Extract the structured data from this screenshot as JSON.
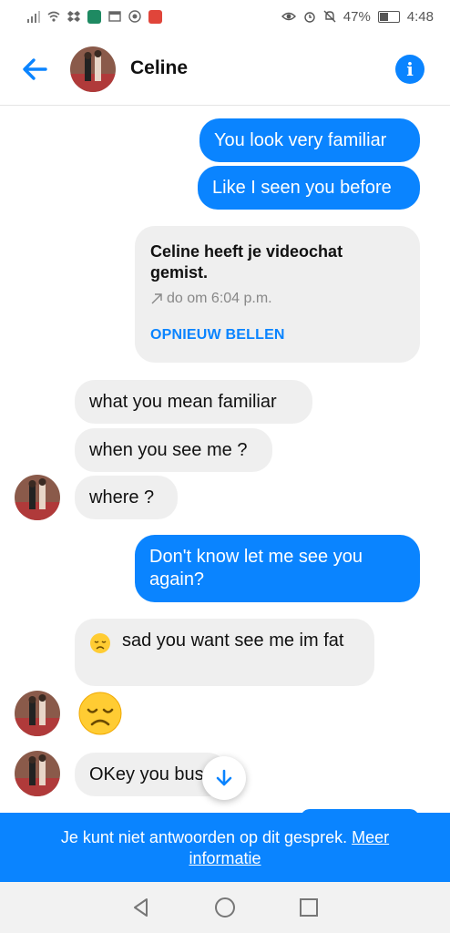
{
  "status_bar": {
    "battery": "47%",
    "time": "4:48"
  },
  "header": {
    "title": "Celine"
  },
  "messages": {
    "out1": "You look very familiar",
    "out2": "Like I seen you before",
    "call_card": {
      "title": "Celine heeft je videochat gemist.",
      "time": "do om 6:04 p.m.",
      "action": "OPNIEUW BELLEN"
    },
    "in1": "what you mean familiar",
    "in2": "when you see me ?",
    "in3": "where  ?",
    "out3": "Don't know let me see you again?",
    "in4": "sad you want see me im fat",
    "in5": "OKey you bus"
  },
  "notice": {
    "text": "Je kunt niet antwoorden op dit gesprek.",
    "link": "Meer informatie"
  },
  "colors": {
    "accent": "#0a84ff",
    "incoming_bubble": "#efefef"
  }
}
